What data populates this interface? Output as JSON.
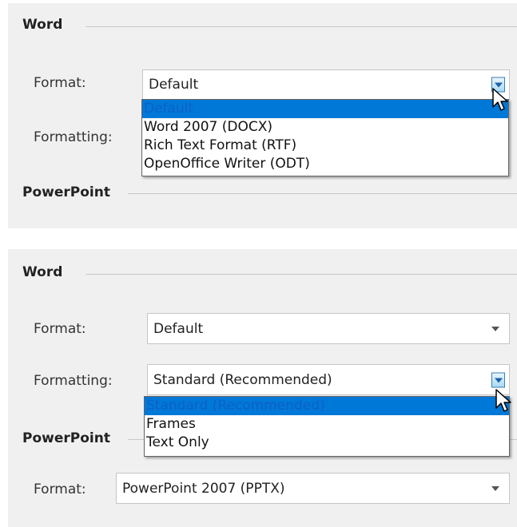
{
  "panel1": {
    "section_word": "Word",
    "format_label": "Format:",
    "format_value": "Default",
    "formatting_label": "Formatting:",
    "format_options": [
      "Default",
      "Word 2007 (DOCX)",
      "Rich Text Format (RTF)",
      "OpenOffice Writer (ODT)"
    ],
    "section_powerpoint": "PowerPoint"
  },
  "panel2": {
    "section_word": "Word",
    "format_label": "Format:",
    "format_value": "Default",
    "formatting_label": "Formatting:",
    "formatting_value": "Standard (Recommended)",
    "formatting_options": [
      "Standard (Recommended)",
      "Frames",
      "Text Only"
    ],
    "section_powerpoint": "PowerPoint",
    "ppt_format_label": "Format:",
    "ppt_format_value": "PowerPoint 2007 (PPTX)"
  },
  "colors": {
    "panel_bg": "#f0f0f0",
    "selection_bg": "#0078d7",
    "selection_text": "#0d60c8",
    "dropdown_button": "#a7d9f5"
  },
  "icons": [
    "dropdown-arrow-icon",
    "mouse-pointer-icon"
  ]
}
